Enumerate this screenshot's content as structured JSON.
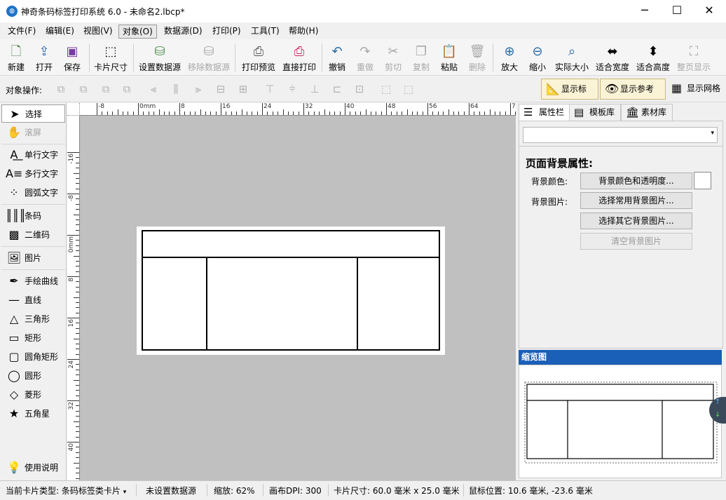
{
  "window": {
    "title": "神奇条码标签打印系统 6.0 - 未命名2.lbcp*",
    "minimize": "─",
    "maximize": "☐",
    "close": "✕"
  },
  "menu": [
    "文件(F)",
    "编辑(E)",
    "视图(V)",
    "对象(O)",
    "数据源(D)",
    "打印(P)",
    "工具(T)",
    "帮助(H)"
  ],
  "toolbar": {
    "new": "新建",
    "open": "打开",
    "save": "保存",
    "card_size": "卡片尺寸",
    "set_datasource": "设置数据源",
    "remove_datasource": "移除数据源",
    "print_preview": "打印预览",
    "direct_print": "直接打印",
    "undo": "撤销",
    "redo": "重做",
    "cut": "剪切",
    "copy": "复制",
    "paste": "粘贴",
    "delete": "删除",
    "zoom_in": "放大",
    "zoom_out": "缩小",
    "actual_size": "实际大小",
    "fit_width": "适合宽度",
    "fit_height": "适合高度",
    "whole_page": "整页显示"
  },
  "opsbar": {
    "label": "对象操作:",
    "show_ruler": "显示标尺",
    "show_guides": "显示参考线",
    "show_grid": "显示网格"
  },
  "palette": {
    "select": "选择",
    "scroll": "滚屏",
    "single_text": "单行文字",
    "multi_text": "多行文字",
    "arc_text": "圆弧文字",
    "barcode": "条码",
    "qrcode": "二维码",
    "image": "图片",
    "freehand": "手绘曲线",
    "line": "直线",
    "triangle": "三角形",
    "rect": "矩形",
    "round_rect": "圆角矩形",
    "circle": "圆形",
    "diamond": "菱形",
    "star": "五角星",
    "help": "使用说明"
  },
  "ruler": {
    "top_labels": [
      "-8",
      "0mm",
      "8",
      "16",
      "24",
      "32",
      "40",
      "48",
      "56",
      "64",
      "72"
    ],
    "left_labels": [
      "-16",
      "-8",
      "0mm",
      "8",
      "16",
      "24",
      "32",
      "40"
    ]
  },
  "rightpanel": {
    "tabs": [
      "属性栏",
      "模板库",
      "素材库"
    ],
    "dropdown_value": "",
    "heading": "页面背景属性:",
    "bg_color_label": "背景颜色:",
    "bg_color_button": "背景颜色和透明度...",
    "bg_color_swatch": "#ffffff",
    "bg_image_label": "背景图片:",
    "btn_common_bg": "选择常用背景图片...",
    "btn_other_bg": "选择其它背景图片...",
    "btn_clear_bg": "清空背景图片",
    "thumbnail_title": "缩览图"
  },
  "status": {
    "card_type": "当前卡片类型: 条码标签类卡片",
    "datasource": "未设置数据源",
    "zoom": "缩放: 62%",
    "dpi": "画布DPI: 300",
    "card_size": "卡片尺寸: 60.0 毫米 x 25.0 毫米",
    "mouse_pos": "鼠标位置: 10.6 毫米, -23.6 毫米"
  },
  "colors": {
    "accent": "#1a5fb8",
    "canvas_bg": "#c0c0c0",
    "toggle_on": "#fbf3d6"
  }
}
